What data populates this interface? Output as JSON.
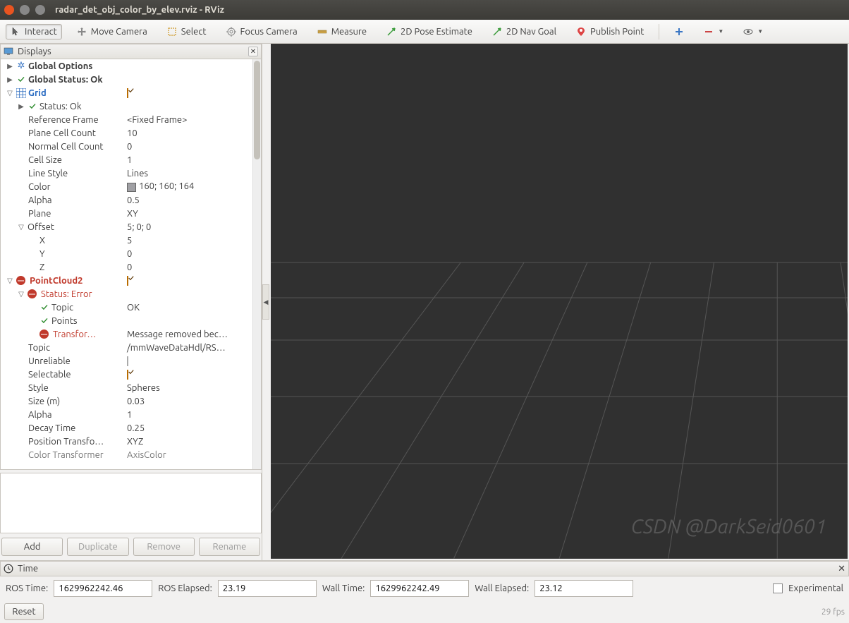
{
  "window": {
    "title": "radar_det_obj_color_by_elev.rviz - RViz"
  },
  "toolbar": {
    "interact": "Interact",
    "move_camera": "Move Camera",
    "select": "Select",
    "focus_camera": "Focus Camera",
    "measure": "Measure",
    "pose_estimate": "2D Pose Estimate",
    "nav_goal": "2D Nav Goal",
    "publish_point": "Publish Point"
  },
  "displays": {
    "title": "Displays",
    "items": {
      "global_options": "Global Options",
      "global_status": "Global Status: Ok",
      "grid_name": "Grid",
      "grid_status": "Status: Ok",
      "ref_frame": {
        "k": "Reference Frame",
        "v": "<Fixed Frame>"
      },
      "plane_cell_count": {
        "k": "Plane Cell Count",
        "v": "10"
      },
      "normal_cell_count": {
        "k": "Normal Cell Count",
        "v": "0"
      },
      "cell_size": {
        "k": "Cell Size",
        "v": "1"
      },
      "line_style": {
        "k": "Line Style",
        "v": "Lines"
      },
      "color": {
        "k": "Color",
        "v": "160; 160; 164"
      },
      "alpha": {
        "k": "Alpha",
        "v": "0.5"
      },
      "plane": {
        "k": "Plane",
        "v": "XY"
      },
      "offset": {
        "k": "Offset",
        "v": "5; 0; 0"
      },
      "offset_x": {
        "k": "X",
        "v": "5"
      },
      "offset_y": {
        "k": "Y",
        "v": "0"
      },
      "offset_z": {
        "k": "Z",
        "v": "0"
      },
      "pointcloud2": "PointCloud2",
      "pc_status": "Status: Error",
      "pc_topic": {
        "k": "Topic",
        "v": "OK"
      },
      "pc_points": "Points",
      "pc_transform": {
        "k": "Transfor…",
        "v": "Message removed bec…"
      },
      "pc_topic2": {
        "k": "Topic",
        "v": "/mmWaveDataHdl/RS…"
      },
      "unreliable": "Unreliable",
      "selectable": "Selectable",
      "style": {
        "k": "Style",
        "v": "Spheres"
      },
      "size_m": {
        "k": "Size (m)",
        "v": "0.03"
      },
      "alpha2": {
        "k": "Alpha",
        "v": "1"
      },
      "decay": {
        "k": "Decay Time",
        "v": "0.25"
      },
      "pos_trans": {
        "k": "Position Transfo…",
        "v": "XYZ"
      },
      "color_trans": {
        "k": "Color Transformer",
        "v": "AxisColor"
      }
    },
    "buttons": {
      "add": "Add",
      "duplicate": "Duplicate",
      "remove": "Remove",
      "rename": "Rename"
    }
  },
  "time": {
    "title": "Time",
    "ros_time_label": "ROS Time:",
    "ros_time": "1629962242.46",
    "ros_elapsed_label": "ROS Elapsed:",
    "ros_elapsed": "23.19",
    "wall_time_label": "Wall Time:",
    "wall_time": "1629962242.49",
    "wall_elapsed_label": "Wall Elapsed:",
    "wall_elapsed": "23.12",
    "experimental": "Experimental"
  },
  "bottom": {
    "reset": "Reset",
    "fps": "29 fps"
  },
  "watermark": "CSDN @DarkSeid0601"
}
